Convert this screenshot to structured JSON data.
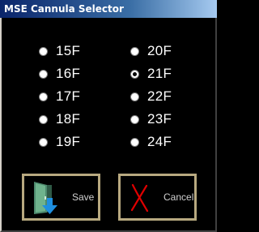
{
  "window": {
    "title": "MSE Cannula Selector"
  },
  "options": {
    "left": [
      {
        "label": "15F",
        "checked": false
      },
      {
        "label": "16F",
        "checked": false
      },
      {
        "label": "17F",
        "checked": false
      },
      {
        "label": "18F",
        "checked": false
      },
      {
        "label": "19F",
        "checked": false
      }
    ],
    "right": [
      {
        "label": "20F",
        "checked": false
      },
      {
        "label": "21F",
        "checked": true
      },
      {
        "label": "22F",
        "checked": false
      },
      {
        "label": "23F",
        "checked": false
      },
      {
        "label": "24F",
        "checked": false
      }
    ]
  },
  "buttons": {
    "save": {
      "label": "Save",
      "icon": "save-door-arrow-icon"
    },
    "cancel": {
      "label": "Cancel",
      "icon": "red-x-icon"
    }
  },
  "colors": {
    "background": "#000000",
    "text": "#ffffff",
    "button_border": "#b8a980",
    "cancel_x": "#e00000"
  }
}
